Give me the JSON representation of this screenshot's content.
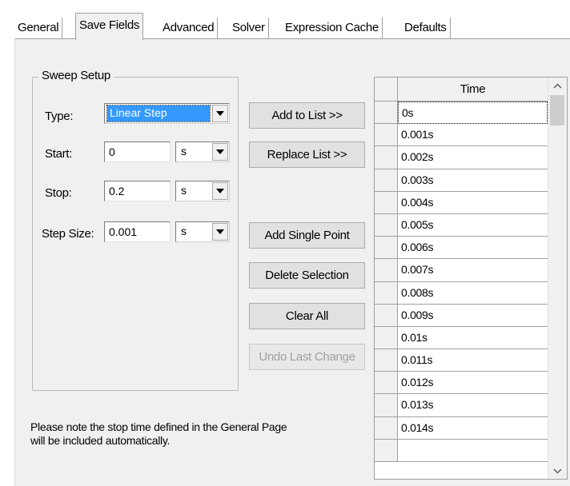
{
  "tabs": [
    {
      "label": "General"
    },
    {
      "label": "Save Fields"
    },
    {
      "label": "Advanced"
    },
    {
      "label": "Solver"
    },
    {
      "label": "Expression Cache"
    },
    {
      "label": "Defaults"
    }
  ],
  "active_tab": "Save Fields",
  "sweep": {
    "title": "Sweep Setup",
    "type_label": "Type:",
    "type_value": "Linear Step",
    "start_label": "Start:",
    "start_value": "0",
    "start_unit": "s",
    "stop_label": "Stop:",
    "stop_value": "0.2",
    "stop_unit": "s",
    "step_label": "Step Size:",
    "step_value": "0.001",
    "step_unit": "s"
  },
  "buttons": {
    "add_to_list": "Add to List >>",
    "replace_list": "Replace List >>",
    "add_single_point": "Add Single Point",
    "delete_selection": "Delete Selection",
    "clear_all": "Clear All",
    "undo_last_change": "Undo Last Change"
  },
  "note": {
    "line1": "Please note the stop time defined in the General Page",
    "line2": "will be included automatically."
  },
  "grid": {
    "column_header": "Time",
    "rows": [
      "0s",
      "0.001s",
      "0.002s",
      "0.003s",
      "0.004s",
      "0.005s",
      "0.006s",
      "0.007s",
      "0.008s",
      "0.009s",
      "0.01s",
      "0.011s",
      "0.012s",
      "0.013s",
      "0.014s",
      ""
    ]
  },
  "icons": {
    "dropdown": "chevron-down-icon",
    "scroll_up": "chevron-up-icon",
    "scroll_down": "chevron-down-icon"
  },
  "colors": {
    "selection": "#3399ff",
    "panel": "#f0f0f0",
    "disabled_text": "#a0a0a0"
  }
}
